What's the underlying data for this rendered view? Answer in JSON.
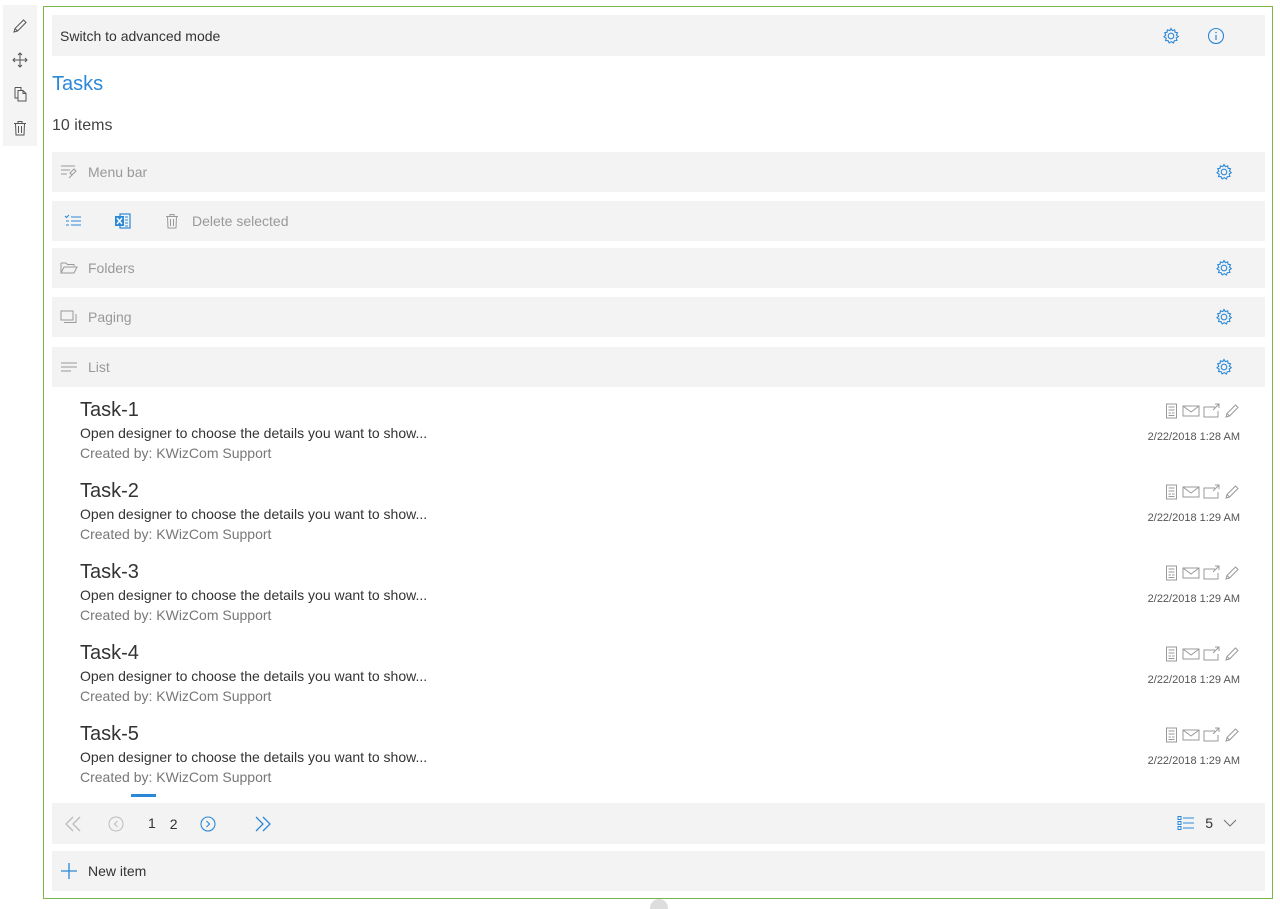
{
  "toolrail": {
    "icons": [
      "pencil-icon",
      "move-icon",
      "copy-icon",
      "trash-icon"
    ]
  },
  "topbar": {
    "label": "Switch to advanced mode"
  },
  "header": {
    "title": "Tasks",
    "count": "10 items"
  },
  "sections": {
    "menu_bar": "Menu bar",
    "delete_selected": "Delete selected",
    "folders": "Folders",
    "paging": "Paging",
    "list": "List"
  },
  "items": [
    {
      "name": "Task-1",
      "desc": "Open designer to choose the details you want to show...",
      "by": "Created by: KWizCom Support",
      "date": "2/22/2018 1:28 AM"
    },
    {
      "name": "Task-2",
      "desc": "Open designer to choose the details you want to show...",
      "by": "Created by: KWizCom Support",
      "date": "2/22/2018 1:29 AM"
    },
    {
      "name": "Task-3",
      "desc": "Open designer to choose the details you want to show...",
      "by": "Created by: KWizCom Support",
      "date": "2/22/2018 1:29 AM"
    },
    {
      "name": "Task-4",
      "desc": "Open designer to choose the details you want to show...",
      "by": "Created by: KWizCom Support",
      "date": "2/22/2018 1:29 AM"
    },
    {
      "name": "Task-5",
      "desc": "Open designer to choose the details you want to show...",
      "by": "Created by: KWizCom Support",
      "date": "2/22/2018 1:29 AM"
    }
  ],
  "pager": {
    "pages": [
      "1",
      "2"
    ],
    "current_page": "1",
    "page_size": "5"
  },
  "new_item": {
    "label": "New item"
  },
  "colors": {
    "accent": "#2b88d8",
    "frame_border": "#7ab648",
    "bar_bg": "#f3f3f3"
  }
}
